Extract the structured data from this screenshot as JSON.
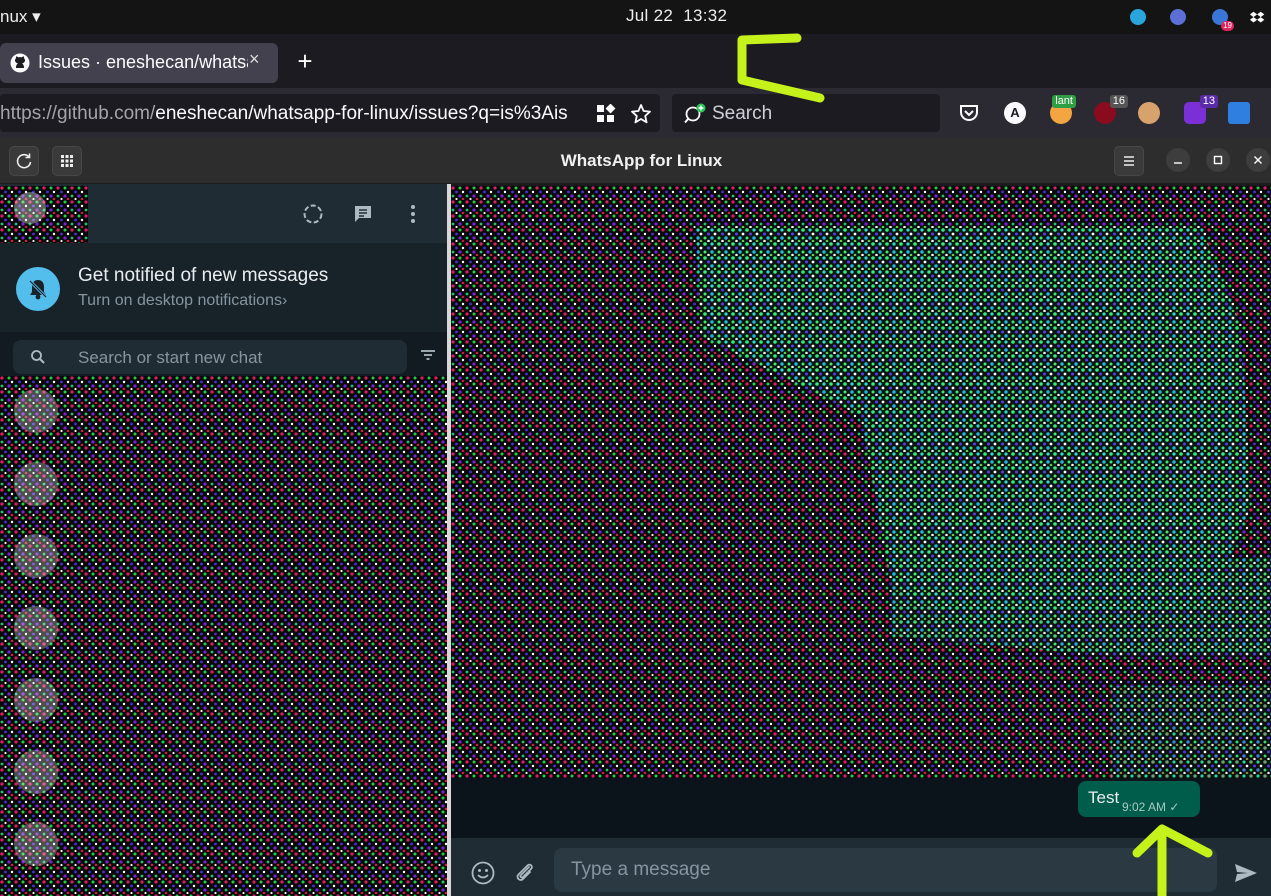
{
  "system_bar": {
    "app_menu": "nux ▾",
    "date": "Jul 22",
    "time": "13:32",
    "tray_badge": "19"
  },
  "browser": {
    "tab_title": "Issues · eneshecan/whatsapp-for-linux",
    "close_glyph": "×",
    "new_tab_glyph": "+",
    "url_prefix": "https://github.com/",
    "url_rest": "eneshecan/whatsapp-for-linux/issues?q=is%3Ais",
    "search_placeholder": "Search",
    "extensions": [
      {
        "name": "lant",
        "badge": ""
      },
      {
        "name": "ublock",
        "badge": "16"
      },
      {
        "name": "purple",
        "badge": "13"
      }
    ]
  },
  "app": {
    "title": "WhatsApp for Linux",
    "left": {
      "notification_title": "Get notified of new messages",
      "notification_subtitle": "Turn on desktop notifications",
      "notification_chevron": "›",
      "search_placeholder": "Search or start new chat"
    },
    "conversation": {
      "message_text": "Test",
      "message_time": "9:02 AM",
      "tick": "✓",
      "input_placeholder": "Type a message"
    }
  },
  "colors": {
    "whatsapp_panel": "#202c33",
    "whatsapp_bubble": "#005c4b",
    "notif_bell": "#53bdeb",
    "annotation_arrow": "#c6f21b"
  }
}
